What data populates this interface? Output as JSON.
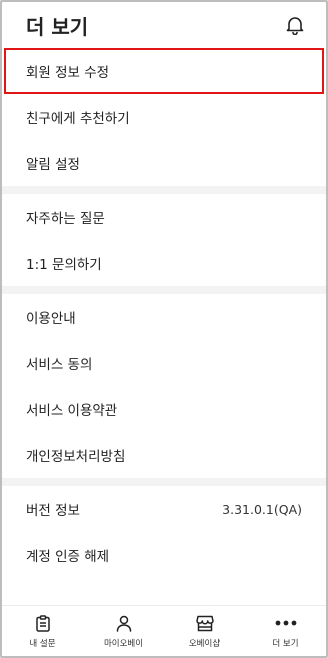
{
  "header": {
    "title": "더 보기",
    "icon": "bell-icon"
  },
  "sections": [
    {
      "items": [
        {
          "label": "회원 정보 수정",
          "highlighted": true
        },
        {
          "label": "친구에게 추천하기"
        },
        {
          "label": "알림 설정"
        }
      ]
    },
    {
      "items": [
        {
          "label": "자주하는 질문"
        },
        {
          "label": "1:1 문의하기"
        }
      ]
    },
    {
      "items": [
        {
          "label": "이용안내"
        },
        {
          "label": "서비스 동의"
        },
        {
          "label": "서비스 이용약관"
        },
        {
          "label": "개인정보처리방침"
        }
      ]
    },
    {
      "items": [
        {
          "label": "버전 정보",
          "value": "3.31.0.1(QA)"
        },
        {
          "label": "계정 인증 해제"
        }
      ]
    }
  ],
  "tabbar": [
    {
      "label": "내 설문",
      "icon": "clipboard-icon"
    },
    {
      "label": "마이오베이",
      "icon": "person-icon"
    },
    {
      "label": "오베이샵",
      "icon": "shop-icon"
    },
    {
      "label": "더 보기",
      "icon": "more-dots-icon"
    }
  ],
  "colors": {
    "highlight": "#e01515",
    "divider": "#f3f3f3"
  }
}
